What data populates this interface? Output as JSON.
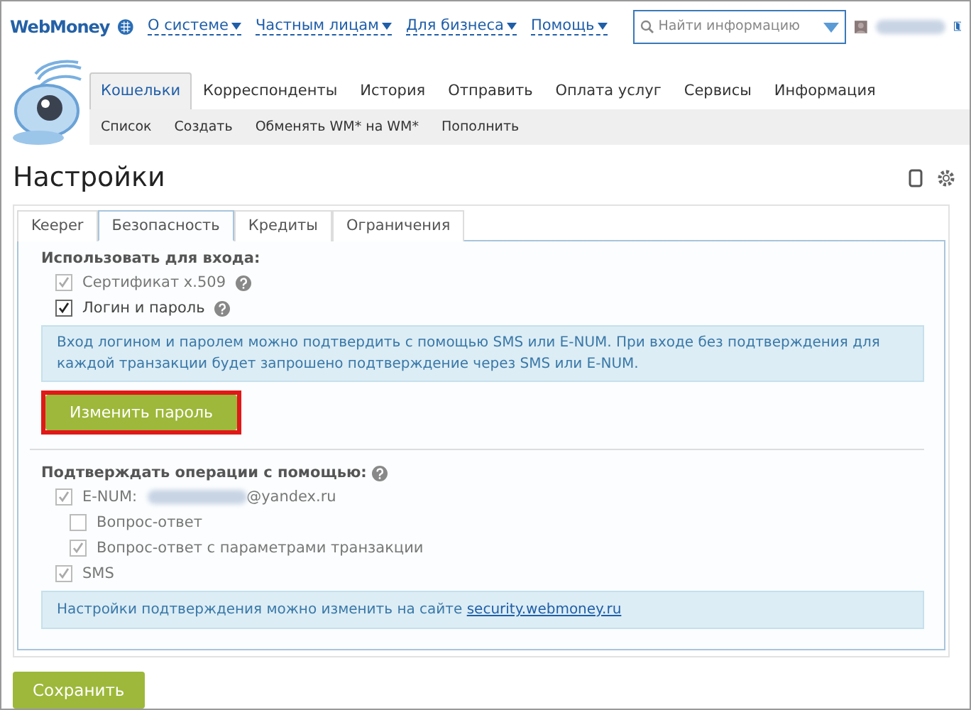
{
  "header": {
    "logo": "WebMoney",
    "nav": [
      {
        "label": "О системе"
      },
      {
        "label": "Частным лицам"
      },
      {
        "label": "Для бизнеса"
      },
      {
        "label": "Помощь"
      }
    ],
    "search": {
      "placeholder": "Найти информацию"
    }
  },
  "main_tabs": [
    {
      "label": "Кошельки",
      "selected": true
    },
    {
      "label": "Корреспонденты",
      "selected": false
    },
    {
      "label": "История",
      "selected": false
    },
    {
      "label": "Отправить",
      "selected": false
    },
    {
      "label": "Оплата услуг",
      "selected": false
    },
    {
      "label": "Сервисы",
      "selected": false
    },
    {
      "label": "Информация",
      "selected": false
    }
  ],
  "sub_nav": [
    "Список",
    "Создать",
    "Обменять WM* на WM*",
    "Пополнить"
  ],
  "title": "Настройки",
  "settings_tabs": [
    {
      "label": "Keeper",
      "selected": false
    },
    {
      "label": "Безопасность",
      "selected": true
    },
    {
      "label": "Кредиты",
      "selected": false
    },
    {
      "label": "Ограничения",
      "selected": false
    }
  ],
  "login_section": {
    "heading": "Использовать для входа:",
    "options": [
      {
        "label": "Сертификат x.509",
        "checked": true,
        "disabled": true,
        "help": true
      },
      {
        "label": "Логин и пароль",
        "checked": true,
        "disabled": false,
        "help": true
      }
    ],
    "info": "Вход логином и паролем можно подтвердить с помощью SMS или E-NUM. При входе без подтверждения для каждой транзакции будет запрошено подтверждение через SMS или E-NUM.",
    "button": "Изменить пароль",
    "highlighted": true
  },
  "confirm_section": {
    "heading": "Подтверждать операции с помощью:",
    "options": [
      {
        "label": "E-NUM:",
        "suffix": "@yandex.ru",
        "checked": true,
        "disabled": true,
        "children": [
          {
            "label": "Вопрос-ответ",
            "checked": false,
            "disabled": true
          },
          {
            "label": "Вопрос-ответ с параметрами транзакции",
            "checked": true,
            "disabled": true
          }
        ]
      },
      {
        "label": "SMS",
        "checked": true,
        "disabled": true
      }
    ],
    "info": "Настройки подтверждения можно изменить на сайте",
    "link": "security.webmoney.ru"
  },
  "save_button": "Сохранить"
}
